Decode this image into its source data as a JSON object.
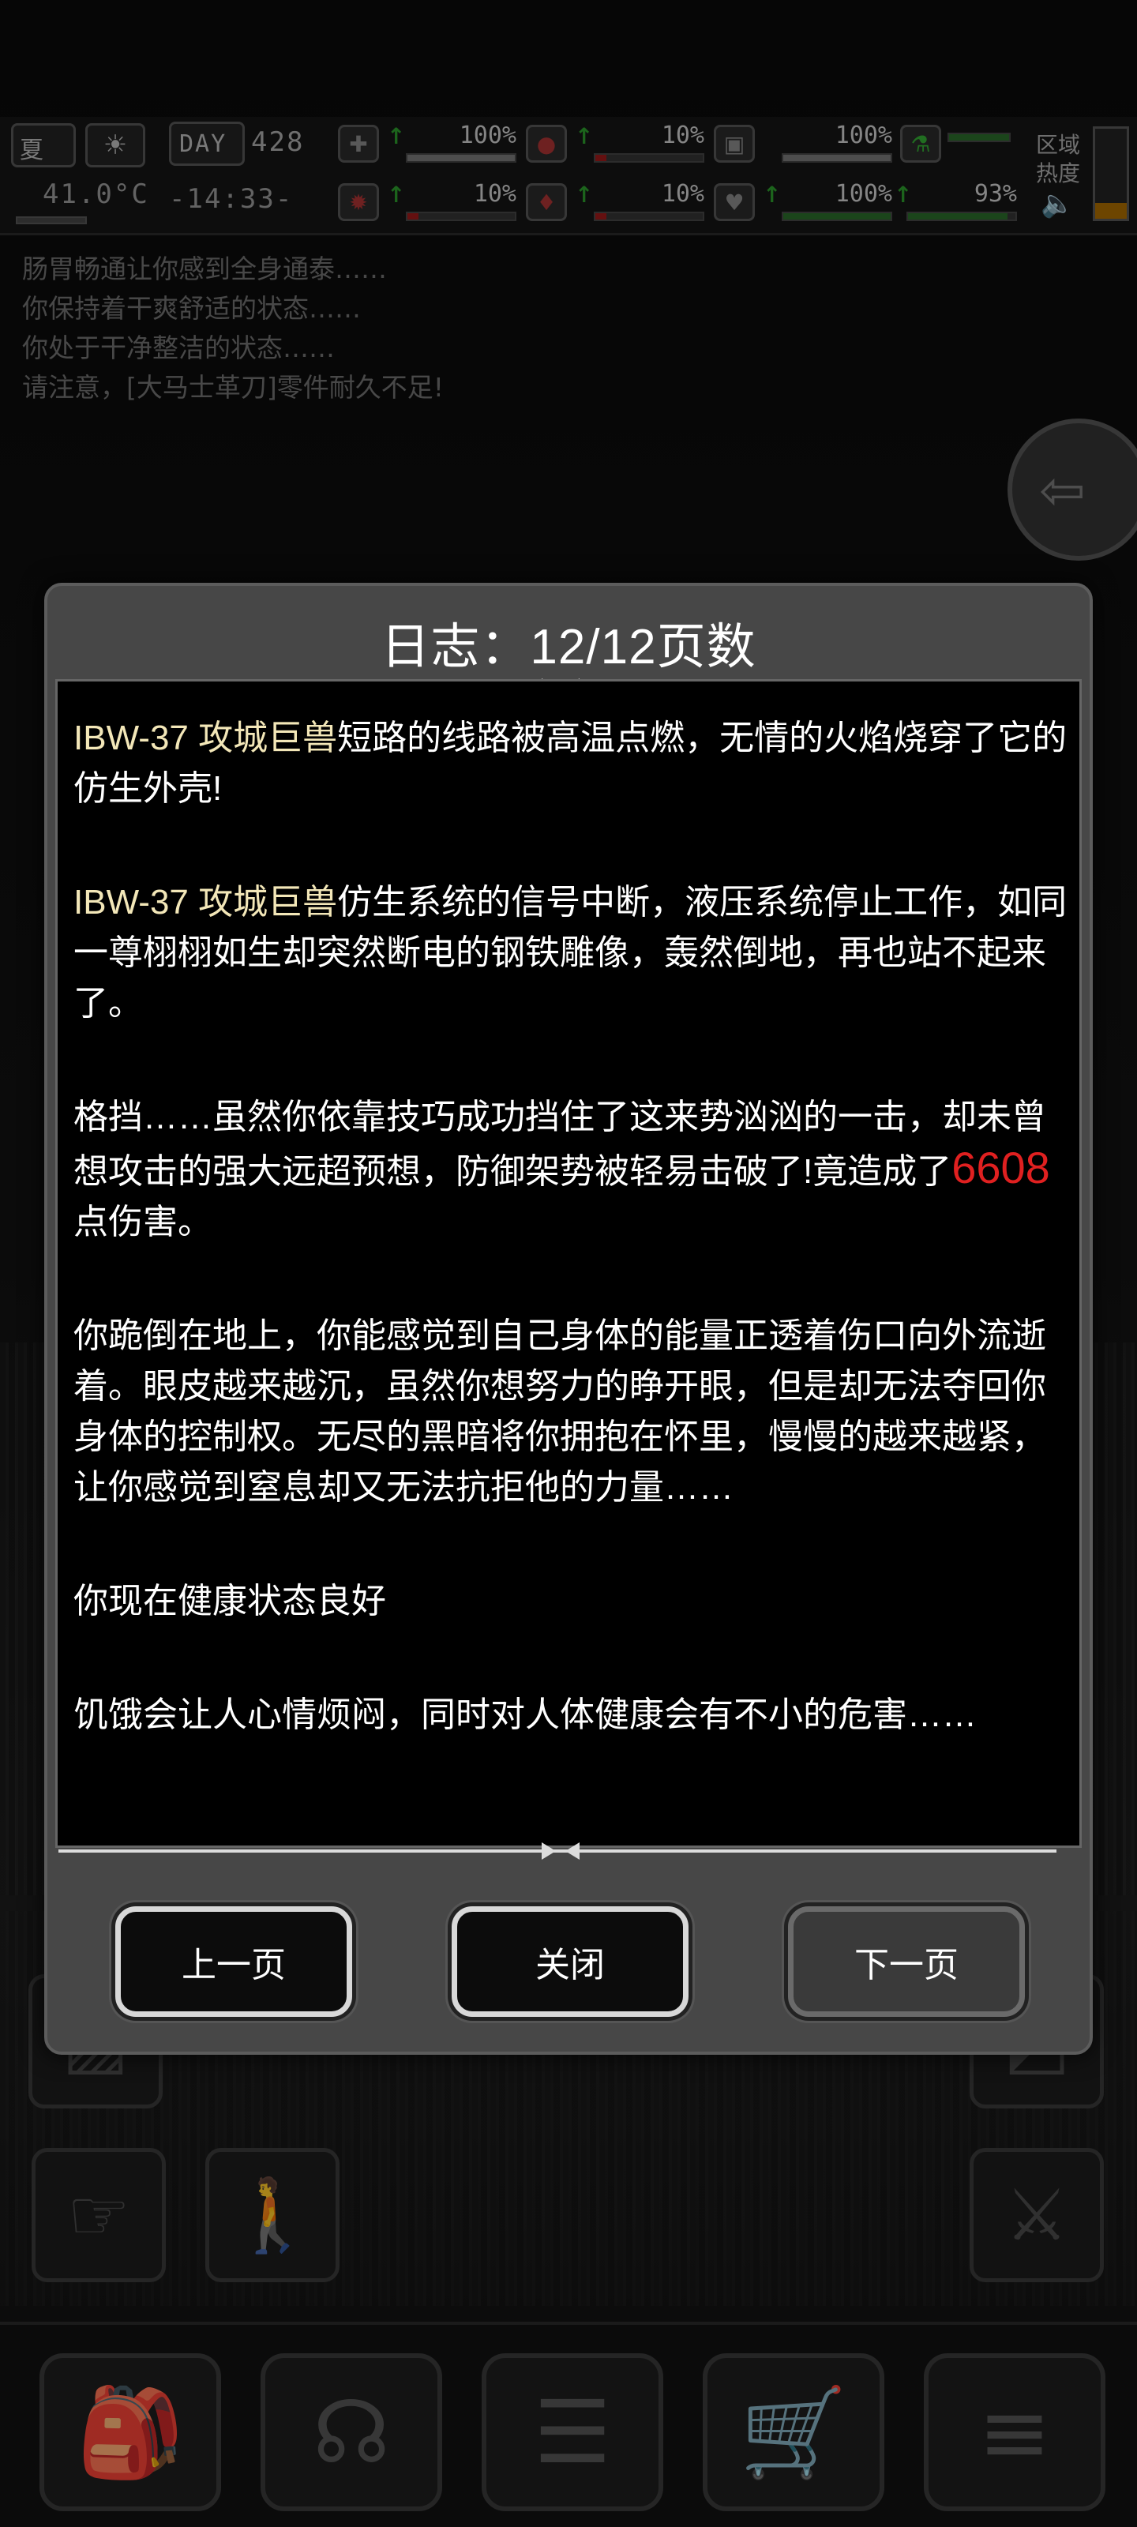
{
  "hud": {
    "season": "夏",
    "day_label": "DAY",
    "day_number": "428",
    "temperature": "41.0°C",
    "time": "-14:33-",
    "zone_heat_label_1": "区域",
    "zone_heat_label_2": "热度",
    "stats_row1": [
      {
        "icon": "medkit-icon",
        "value": "100%",
        "fill": 1.0,
        "color": "gry"
      },
      {
        "icon": "stomach-icon",
        "value": "10%",
        "fill": 0.1,
        "color": "red"
      },
      {
        "icon": "canteen-icon",
        "value": "100%",
        "fill": 1.0,
        "color": "gry"
      },
      {
        "icon": "flask-icon",
        "value": "",
        "fill": 1.0,
        "color": "grn"
      }
    ],
    "stats_row2": [
      {
        "icon": "brain-icon",
        "value": "10%",
        "fill": 0.1,
        "color": "red"
      },
      {
        "icon": "blood-drop-icon",
        "value": "10%",
        "fill": 0.1,
        "color": "red"
      },
      {
        "icon": "heart-icon",
        "value": "100%",
        "fill": 1.0,
        "color": "grn"
      },
      {
        "icon": "stamina-icon",
        "value": "93%",
        "fill": 0.93,
        "color": "grn"
      }
    ]
  },
  "message_log": [
    "肠胃畅通让你感到全身通泰……",
    "你保持着干爽舒适的状态……",
    "你处于干净整洁的状态……",
    "请注意，[大马士革刀]零件耐久不足!"
  ],
  "dialog": {
    "title": "日志：12/12页数",
    "entries": {
      "p1_name": "IBW-37 攻城巨兽",
      "p1_text": "短路的线路被高温点燃，无情的火焰烧穿了它的仿生外壳!",
      "p2_name": "IBW-37 攻城巨兽",
      "p2_text": "仿生系统的信号中断，液压系统停止工作，如同一尊栩栩如生却突然断电的钢铁雕像，轰然倒地，再也站不起来了。",
      "p3_text_a": "格挡……虽然你依靠技巧成功挡住了这来势汹汹的一击，却未曾想攻击的强大远超预想，防御架势被轻易击破了!竟造成了",
      "p3_damage": "6608",
      "p3_text_b": "点伤害。",
      "p4_text": "你跪倒在地上，你能感觉到自己身体的能量正透着伤口向外流逝着。眼皮越来越沉，虽然你想努力的睁开眼，但是却无法夺回你身体的控制权。无尽的黑暗将你拥抱在怀里，慢慢的越来越紧，让你感觉到窒息却又无法抗拒他的力量……",
      "p5_text": "你现在健康状态良好",
      "p6_text": "饥饿会让人心情烦闷，同时对人体健康会有不小的危害……"
    },
    "buttons": {
      "prev": "上一页",
      "close": "关闭",
      "next": "下一页"
    }
  },
  "bottom_nav": [
    {
      "icon": "backpack-icon"
    },
    {
      "icon": "brain-skills-icon"
    },
    {
      "icon": "journal-icon"
    },
    {
      "icon": "shop-cart-icon"
    },
    {
      "icon": "menu-list-icon"
    }
  ],
  "colors": {
    "highlight_name": "#f3e7b8",
    "damage": "#e02020",
    "dialog_bg": "#474747"
  }
}
